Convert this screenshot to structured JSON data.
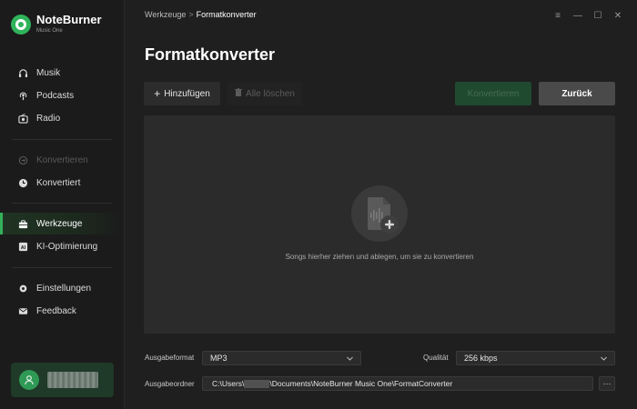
{
  "brand": {
    "name": "NoteBurner",
    "subtitle": "Music One"
  },
  "sidebar": {
    "items": [
      {
        "label": "Musik",
        "icon": "headphones-icon",
        "state": "normal"
      },
      {
        "label": "Podcasts",
        "icon": "podcast-icon",
        "state": "normal"
      },
      {
        "label": "Radio",
        "icon": "radio-icon",
        "state": "normal"
      },
      {
        "label": "Konvertieren",
        "icon": "convert-icon",
        "state": "disabled"
      },
      {
        "label": "Konvertiert",
        "icon": "clock-icon",
        "state": "normal"
      },
      {
        "label": "Werkzeuge",
        "icon": "toolbox-icon",
        "state": "active"
      },
      {
        "label": "KI-Optimierung",
        "icon": "ai-icon",
        "state": "normal"
      },
      {
        "label": "Einstellungen",
        "icon": "gear-icon",
        "state": "normal"
      },
      {
        "label": "Feedback",
        "icon": "mail-icon",
        "state": "normal"
      }
    ]
  },
  "breadcrumb": {
    "parent": "Werkzeuge",
    "separator": ">",
    "current": "Formatkonverter"
  },
  "window_controls": {
    "menu": "≡",
    "minimize": "—",
    "maximize": "☐",
    "close": "✕"
  },
  "page": {
    "title": "Formatkonverter"
  },
  "toolbar": {
    "add_label": "Hinzufügen",
    "clear_label": "Alle löschen",
    "convert_label": "Konvertieren",
    "back_label": "Zurück"
  },
  "dropzone": {
    "hint": "Songs hierher ziehen und ablegen, um sie zu konvertieren"
  },
  "output": {
    "format_label": "Ausgabeformat",
    "format_value": "MP3",
    "quality_label": "Qualität",
    "quality_value": "256 kbps",
    "folder_label": "Ausgabeordner",
    "folder_prefix": "C:\\Users\\",
    "folder_suffix": "\\Documents\\NoteBurner Music One\\FormatConverter",
    "browse_label": "···"
  },
  "colors": {
    "accent": "#33b05a",
    "background": "#1f1f1f",
    "panel": "#2b2b2b"
  }
}
